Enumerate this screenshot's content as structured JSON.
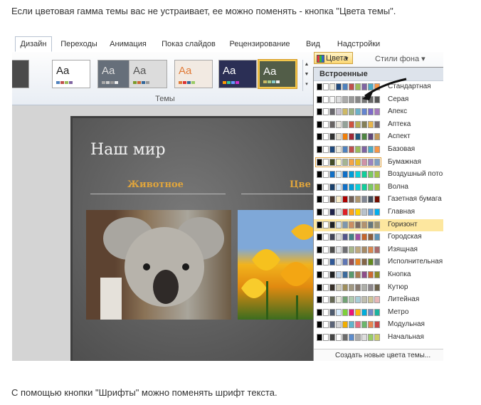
{
  "intro_text": "Если цветовая гамма темы вас не устраивает, ее можно поменять - кнопка \"Цвета темы\".",
  "outro_text": "С помощью кнопки \"Шрифты\" можно поменять шрифт текста.",
  "ribbon": {
    "tabs": [
      "Дизайн",
      "Переходы",
      "Анимация",
      "Показ слайдов",
      "Рецензирование",
      "Вид",
      "Надстройки"
    ],
    "active_tab": "Дизайн",
    "group_label": "Темы",
    "colors_button": "Цвета",
    "bg_styles": "Стили фона",
    "theme_label_sample": "Aa"
  },
  "slide": {
    "title": "Наш мир",
    "sub1": "Животное",
    "sub2": "Цве"
  },
  "menu": {
    "header": "Встроенные",
    "footer": "Создать новые цвета темы...",
    "highlighted": "Горизонт",
    "boxed": "Бумажная",
    "items": [
      {
        "name": "Стандартная",
        "colors": [
          "#000000",
          "#ffffff",
          "#eeece1",
          "#1f497d",
          "#4f81bd",
          "#c0504d",
          "#9bbb59",
          "#8064a2",
          "#4bacc6",
          "#f79646"
        ]
      },
      {
        "name": "Серая",
        "colors": [
          "#000000",
          "#ffffff",
          "#f8f8f8",
          "#ddddde",
          "#aaaaaa",
          "#999999",
          "#888888",
          "#777777",
          "#666666",
          "#555555"
        ]
      },
      {
        "name": "Апекс",
        "colors": [
          "#000000",
          "#ffffff",
          "#69676d",
          "#c9c2d1",
          "#ceb966",
          "#9cb084",
          "#6bb1c9",
          "#6585cf",
          "#7e6bc9",
          "#a379bb"
        ]
      },
      {
        "name": "Аптека",
        "colors": [
          "#000000",
          "#ffffff",
          "#696464",
          "#e9e5dc",
          "#93a299",
          "#cf543f",
          "#b5ae53",
          "#848058",
          "#e8b54d",
          "#786c71"
        ]
      },
      {
        "name": "Аспект",
        "colors": [
          "#000000",
          "#ffffff",
          "#323232",
          "#e3ded1",
          "#f07f09",
          "#9f2936",
          "#1b587c",
          "#4e8542",
          "#604878",
          "#c19859"
        ]
      },
      {
        "name": "Базовая",
        "colors": [
          "#000000",
          "#ffffff",
          "#1f497d",
          "#eeece1",
          "#4f81bd",
          "#c0504d",
          "#9bbb59",
          "#8064a2",
          "#4bacc6",
          "#f79646"
        ]
      },
      {
        "name": "Бумажная",
        "colors": [
          "#000000",
          "#ffffff",
          "#444d26",
          "#fefac9",
          "#a5b592",
          "#f3a447",
          "#e7bc29",
          "#d092a7",
          "#9c85c0",
          "#809ec2"
        ]
      },
      {
        "name": "Воздушный поток",
        "colors": [
          "#000000",
          "#ffffff",
          "#0f6fc6",
          "#dbeff9",
          "#0f6fc6",
          "#009dd9",
          "#0bd0d9",
          "#10cf9b",
          "#7cca62",
          "#a5c249"
        ]
      },
      {
        "name": "Волна",
        "colors": [
          "#000000",
          "#ffffff",
          "#17406d",
          "#dbefff",
          "#0f6fc6",
          "#009dd9",
          "#0bd0d9",
          "#10cf9b",
          "#7cca62",
          "#a5c249"
        ]
      },
      {
        "name": "Газетная бумага",
        "colors": [
          "#000000",
          "#ffffff",
          "#4e3b30",
          "#fbeec9",
          "#ad0101",
          "#726056",
          "#ac956e",
          "#808693",
          "#424e5b",
          "#730e00"
        ]
      },
      {
        "name": "Главная",
        "colors": [
          "#000000",
          "#ffffff",
          "#20244b",
          "#dfe3e5",
          "#df1f26",
          "#faa01e",
          "#ffd200",
          "#b8c2cc",
          "#6a9ed5",
          "#00aeef"
        ]
      },
      {
        "name": "Горизонт",
        "colors": [
          "#000000",
          "#ffffff",
          "#1f2123",
          "#dce5e8",
          "#7e97ad",
          "#cc8e60",
          "#7a6a60",
          "#b4936d",
          "#67787b",
          "#9d936f"
        ]
      },
      {
        "name": "Городская",
        "colors": [
          "#000000",
          "#ffffff",
          "#424456",
          "#dedede",
          "#53548a",
          "#438086",
          "#a04da3",
          "#c4652d",
          "#8b5d3d",
          "#5c92b5"
        ]
      },
      {
        "name": "Изящная",
        "colors": [
          "#000000",
          "#ffffff",
          "#4d4d4d",
          "#e5e7e9",
          "#6f6f74",
          "#a7b789",
          "#bea97f",
          "#a68b67",
          "#d8874f",
          "#aa6b6b"
        ]
      },
      {
        "name": "Исполнительная",
        "colors": [
          "#000000",
          "#ffffff",
          "#2f5897",
          "#e4e9ef",
          "#6076b4",
          "#9c5252",
          "#e68422",
          "#846648",
          "#63891f",
          "#758085"
        ]
      },
      {
        "name": "Кнопка",
        "colors": [
          "#000000",
          "#ffffff",
          "#1f2123",
          "#c0d4e6",
          "#3b6a9c",
          "#5a9a6e",
          "#ab7b50",
          "#8e4d8a",
          "#cd6b33",
          "#8b8b2b"
        ]
      },
      {
        "name": "Кутюр",
        "colors": [
          "#000000",
          "#ffffff",
          "#37302a",
          "#d0ccb9",
          "#9e8e5c",
          "#a09781",
          "#85776d",
          "#aeafa9",
          "#8d878b",
          "#6b6149"
        ]
      },
      {
        "name": "Литейная",
        "colors": [
          "#000000",
          "#ffffff",
          "#676a55",
          "#eaebde",
          "#72a376",
          "#b0ccb0",
          "#a8cdd7",
          "#c0beaf",
          "#cec597",
          "#e8b7b7"
        ]
      },
      {
        "name": "Метро",
        "colors": [
          "#000000",
          "#ffffff",
          "#4e5b6f",
          "#d6ecff",
          "#7fd13b",
          "#ea157a",
          "#feb80a",
          "#00addc",
          "#738ac8",
          "#1ab39f"
        ]
      },
      {
        "name": "Модульная",
        "colors": [
          "#000000",
          "#ffffff",
          "#5a6378",
          "#d4d4d6",
          "#f0ad00",
          "#60b5cc",
          "#e66c7d",
          "#6bb76d",
          "#e88651",
          "#c64847"
        ]
      },
      {
        "name": "Начальная",
        "colors": [
          "#000000",
          "#ffffff",
          "#464646",
          "#ffffff",
          "#6b6b6b",
          "#5c8ccc",
          "#aaaaaa",
          "#dddddd",
          "#99cc66",
          "#cccc66"
        ]
      }
    ]
  },
  "themes": [
    {
      "bg": "#4a4a4a",
      "fg": "#ffffff",
      "bars": [
        "#999",
        "#bbb",
        "#ddd",
        "#eee"
      ]
    },
    {
      "bg": "#ffffff",
      "fg": "#222222",
      "bars": [
        "#4f81bd",
        "#c0504d",
        "#9bbb59",
        "#8064a2"
      ]
    },
    {
      "bg": "#666f7a",
      "fg": "#e0e0e0",
      "bars": [
        "#aaa",
        "#ccc",
        "#999",
        "#eee"
      ]
    },
    {
      "bg": "#dcdcdc",
      "fg": "#555555",
      "bars": [
        "#7a9a2a",
        "#c63",
        "#369",
        "#999"
      ]
    },
    {
      "bg": "#f2eae2",
      "fg": "#e07a37",
      "bars": [
        "#e07a37",
        "#d33",
        "#369",
        "#9c6"
      ]
    },
    {
      "bg": "#2b2f55",
      "fg": "#ffffff",
      "bars": [
        "#f90",
        "#3c9",
        "#69f",
        "#c3c"
      ]
    },
    {
      "bg": "#525d48",
      "fg": "#ffffff",
      "bars": [
        "#cb6",
        "#ac8",
        "#8cc",
        "#eee"
      ]
    }
  ]
}
